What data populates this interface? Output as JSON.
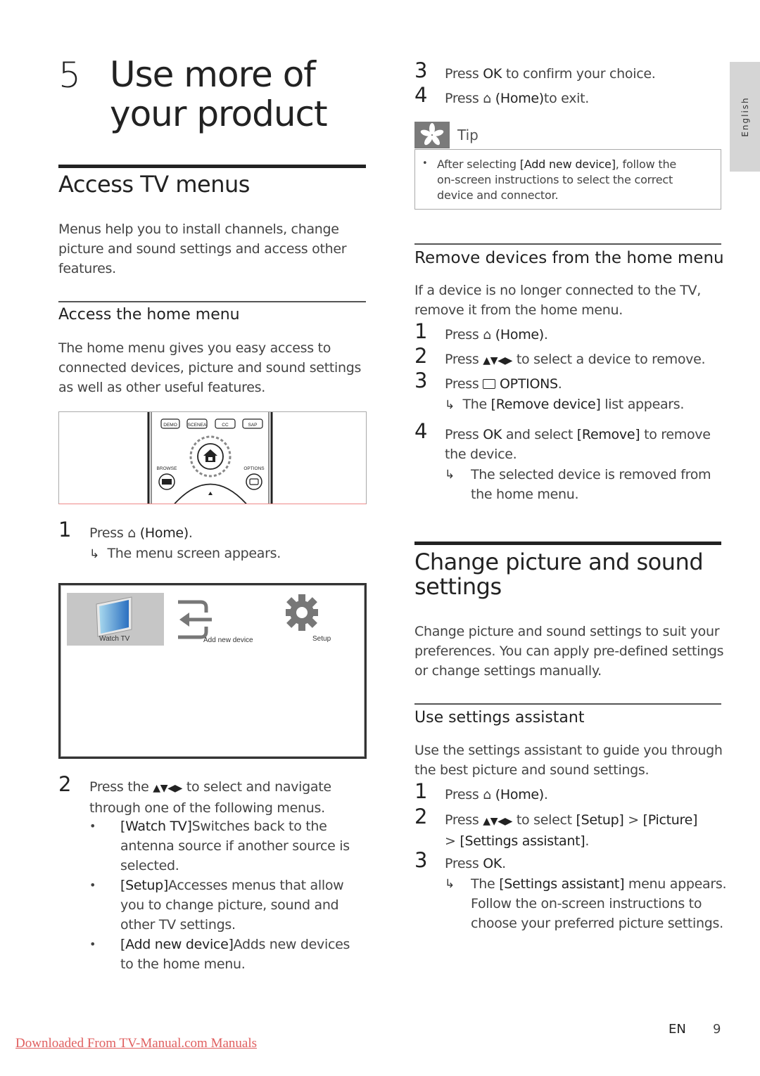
{
  "chapter": {
    "number": "5",
    "title_line1": "Use more of",
    "title_line2": "your product"
  },
  "section_access": {
    "title": "Access TV menus",
    "intro": [
      "Menus help you to install channels, change",
      "picture and sound settings and access other",
      "features."
    ]
  },
  "subsection_home": {
    "title": "Access the home menu",
    "intro": [
      "The home menu gives you easy access to",
      "connected devices, picture and sound settings",
      "as well as other useful features."
    ]
  },
  "remote": {
    "buttons": [
      "DEMO",
      "SCENEA",
      "CC",
      "SAP"
    ],
    "browse_label": "BROWSE",
    "options_label": "OPTIONS"
  },
  "home_steps": {
    "step1": {
      "num": "1",
      "press": "Press",
      "key": "(Home)",
      "end": ".",
      "result": "The menu screen appears."
    },
    "step2": {
      "num": "2",
      "line1_a": "Press the",
      "line1_b": "to select and navigate",
      "line2": "through one of the following menus.",
      "bullets": [
        {
          "key": "[Watch TV]",
          "lines": [
            "Switches back to the",
            "antenna source if another source is",
            "selected."
          ]
        },
        {
          "key": "[Setup]",
          "lines": [
            "Accesses menus that allow",
            "you to change picture, sound and",
            "other TV settings."
          ]
        },
        {
          "key": "[Add new device]",
          "lines": [
            "Adds new devices",
            "to the home menu."
          ]
        }
      ]
    }
  },
  "menu_screen": {
    "items": [
      {
        "label": "Watch TV",
        "icon": "tv-icon",
        "selected": true
      },
      {
        "label": "Add new device",
        "icon": "input-icon",
        "selected": false
      },
      {
        "label": "Setup",
        "icon": "gear-icon",
        "selected": false
      }
    ]
  },
  "right_steps_top": {
    "step3": {
      "num": "3",
      "a": "Press",
      "key": "OK",
      "b": "to confirm your choice."
    },
    "step4": {
      "num": "4",
      "a": "Press",
      "key": "(Home)",
      "b": "to exit."
    }
  },
  "tip": {
    "label": "Tip",
    "lines": [
      {
        "a": "After selecting ",
        "key": "[Add new device]",
        "b": ", follow the"
      },
      {
        "a": "on-screen instructions to select the correct"
      },
      {
        "a": "device and connector."
      }
    ]
  },
  "section_remove": {
    "title": "Remove devices from the home menu",
    "intro": [
      "If a device is no longer connected to the TV,",
      "remove it from the home menu."
    ],
    "step1": {
      "num": "1",
      "a": "Press",
      "key": "(Home)",
      "b": "."
    },
    "step2": {
      "num": "2",
      "a": "Press",
      "b": "to select a device to remove."
    },
    "step3": {
      "num": "3",
      "a": "Press",
      "key": "OPTIONS",
      "b": ".",
      "result_a": "The ",
      "result_key": "[Remove device]",
      "result_b": " list appears."
    },
    "step4": {
      "num": "4",
      "a": "Press ",
      "key": "OK",
      "b": " and select ",
      "key2": "[Remove]",
      "c": " to remove",
      "line2": "the device.",
      "result_line1": "The selected device is removed from",
      "result_line2": "the home menu."
    }
  },
  "section_change": {
    "title_line1": "Change picture and sound",
    "title_line2": "settings",
    "intro": [
      "Change picture and sound settings to suit your",
      "preferences. You can apply pre-defined settings",
      "or change settings manually."
    ]
  },
  "subsection_assistant": {
    "title": "Use settings assistant",
    "intro": [
      "Use the settings assistant to guide you through",
      "the best picture and sound settings."
    ],
    "step1": {
      "num": "1",
      "a": "Press",
      "key": "(Home)",
      "b": "."
    },
    "step2": {
      "num": "2",
      "a": "Press",
      "b": "to select",
      "key1": "[Setup]",
      "sep": ">",
      "key2": "[Picture]",
      "sep2": ">",
      "key3": "[Settings assistant]",
      "end": "."
    },
    "step3": {
      "num": "3",
      "a": "Press ",
      "key": "OK",
      "b": ".",
      "result_a": "The ",
      "result_key": "[Settings assistant]",
      "result_b": " menu appears.",
      "result_line2": "Follow the on-screen instructions to",
      "result_line3": "choose your preferred picture settings."
    }
  },
  "nav_arrows": "▲▼◀▶",
  "side_tab": "English",
  "footer": {
    "link": "Downloaded From TV-Manual.com Manuals",
    "lang": "EN",
    "page": "9"
  }
}
